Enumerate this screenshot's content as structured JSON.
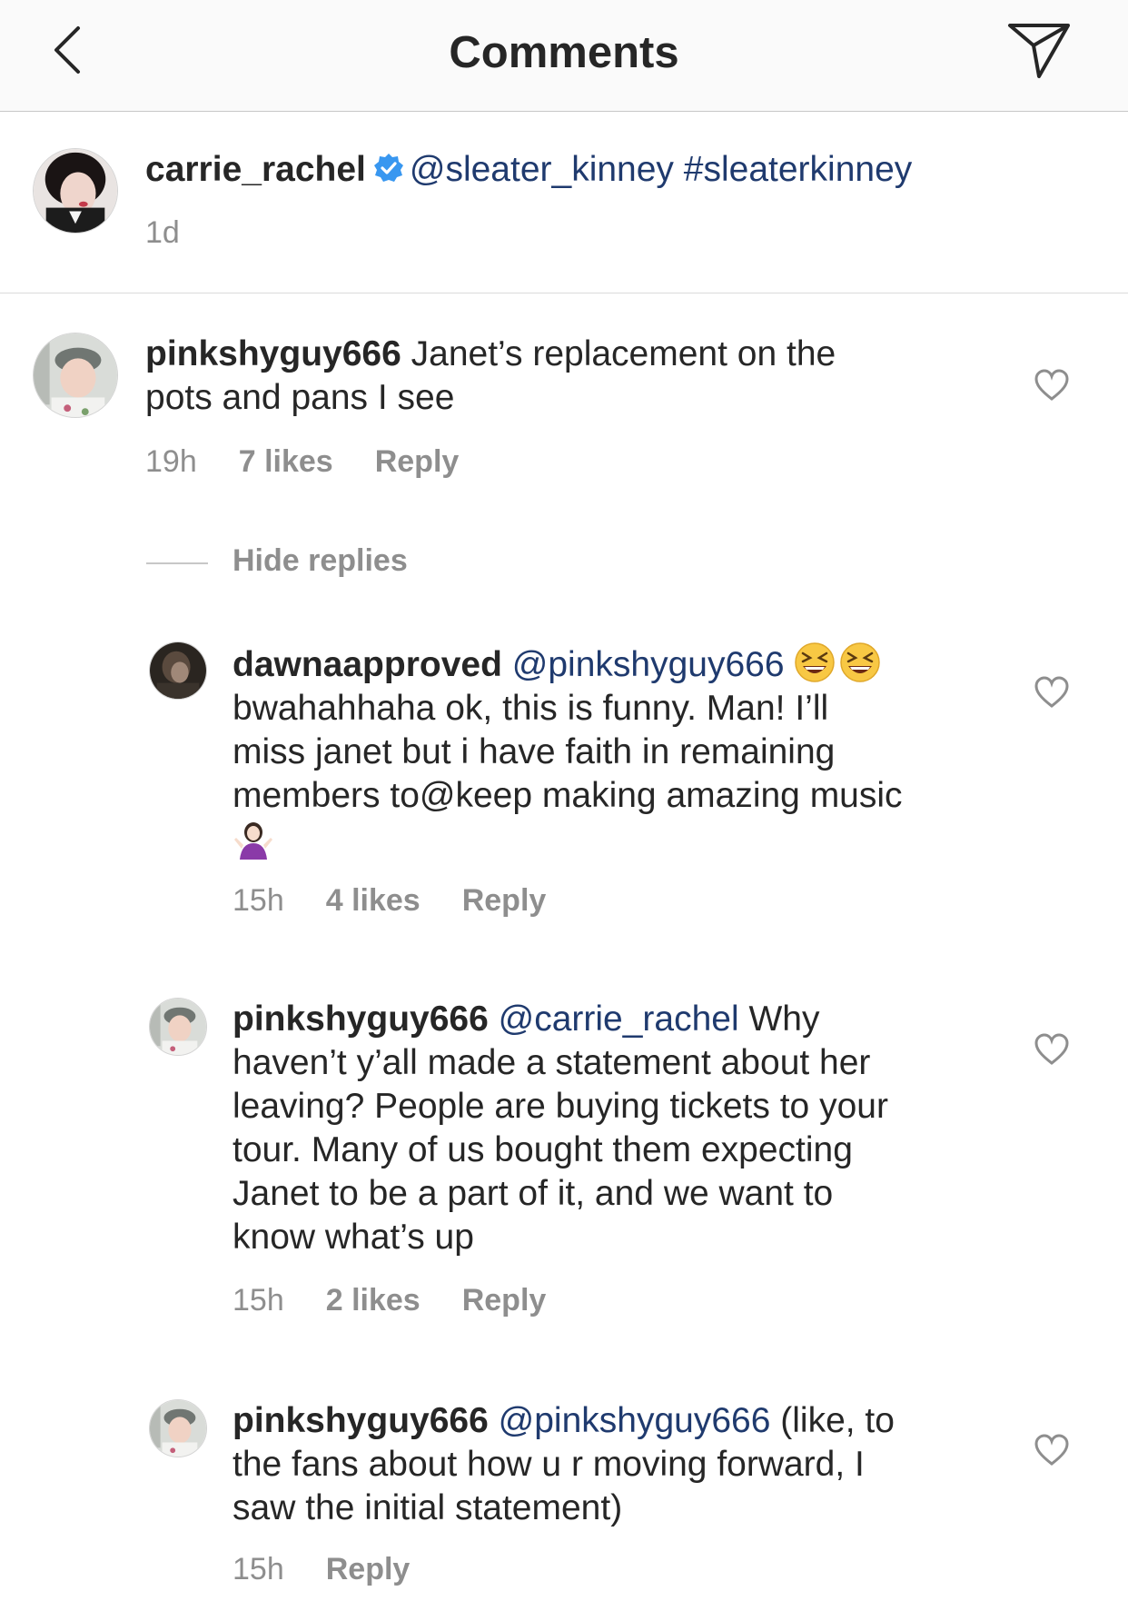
{
  "header": {
    "title": "Comments",
    "back_icon": "chevron-left-icon",
    "share_icon": "paper-plane-icon"
  },
  "caption": {
    "username": "carrie_rachel",
    "verified": true,
    "mention": "@sleater_kinney",
    "hashtag": "#sleaterkinney",
    "time": "1d"
  },
  "comments": [
    {
      "username": "pinkshyguy666",
      "text_line1": "Janet’s replacement on the",
      "text_line2": "pots and pans I see",
      "time": "19h",
      "likes": "7 likes",
      "reply": "Reply"
    }
  ],
  "hide_replies": "Hide replies",
  "replies": [
    {
      "username": "dawnaapproved",
      "mention": "@pinkshyguy666",
      "lines": [
        "bwahahhaha ok, this is funny. Man! I’ll",
        "miss janet but i have faith in remaining",
        "members to@keep making amazing music"
      ],
      "emoji_after_mention": "😆😆",
      "emoji_end": "🤷🏻‍♀️",
      "time": "15h",
      "likes": "4 likes",
      "reply": "Reply"
    },
    {
      "username": "pinkshyguy666",
      "mention": "@carrie_rachel",
      "first_line_tail": "Why",
      "lines": [
        "haven’t y’all made a statement about her",
        "leaving? People are buying tickets to your",
        "tour. Many of us bought them expecting",
        "Janet to be a part of it, and we want to",
        "know what’s up"
      ],
      "time": "15h",
      "likes": "2 likes",
      "reply": "Reply"
    },
    {
      "username": "pinkshyguy666",
      "mention": "@pinkshyguy666",
      "first_line_tail": "(like, to",
      "lines": [
        "the fans about how u r moving forward, I",
        "saw the initial statement)"
      ],
      "time": "15h",
      "reply": "Reply"
    }
  ],
  "colors": {
    "mention": "#1f3a6e",
    "meta_gray": "#8e8e8e",
    "verified_blue": "#3897f0"
  }
}
